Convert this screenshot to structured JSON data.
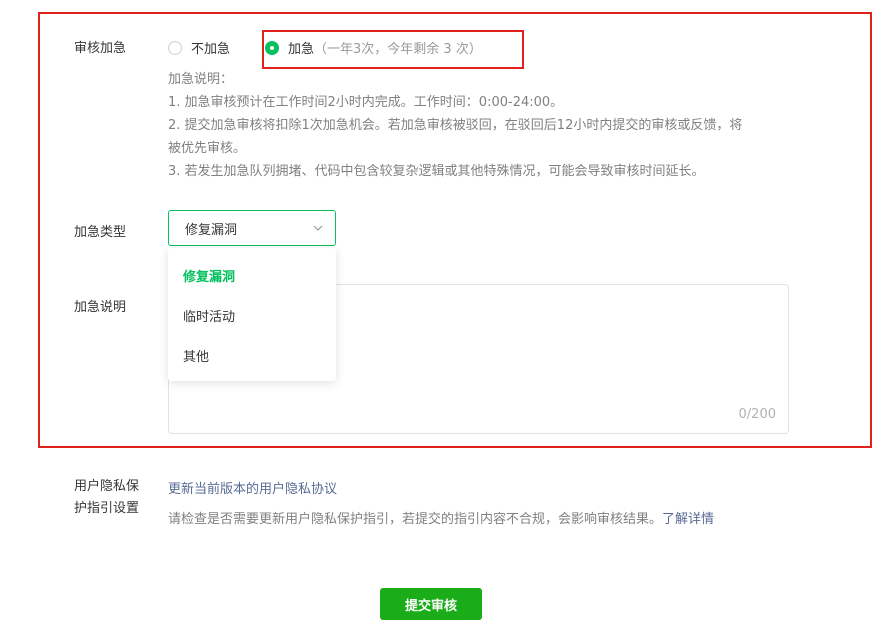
{
  "expedite": {
    "label": "审核加急",
    "option_no": "不加急",
    "option_yes": "加急",
    "option_yes_note": "（一年3次，今年剩余  3  次）",
    "selected": "加急",
    "desc_title": "加急说明：",
    "desc_lines": [
      "1. 加急审核预计在工作时间2小时内完成。工作时间：0:00-24:00。",
      "2. 提交加急审核将扣除1次加急机会。若加急审核被驳回，在驳回后12小时内提交的审核或反馈，将",
      "被优先审核。",
      "3. 若发生加急队列拥堵、代码中包含较复杂逻辑或其他特殊情况，可能会导致审核时间延长。"
    ]
  },
  "type": {
    "label": "加急类型",
    "selected": "修复漏洞",
    "options": [
      "修复漏洞",
      "临时活动",
      "其他"
    ]
  },
  "explain": {
    "label": "加急说明",
    "counter": "0/200"
  },
  "privacy": {
    "label_line1": "用户隐私保",
    "label_line2": "护指引设置",
    "update_link": "更新当前版本的用户隐私协议",
    "hint": "请检查是否需要更新用户隐私保护指引，若提交的指引内容不合规，会影响审核结果。",
    "detail_link": "了解详情"
  },
  "submit_label": "提交审核",
  "colors": {
    "accent": "#07c160",
    "button": "#1aad19",
    "highlight": "#e0211e",
    "link": "#576b95"
  }
}
